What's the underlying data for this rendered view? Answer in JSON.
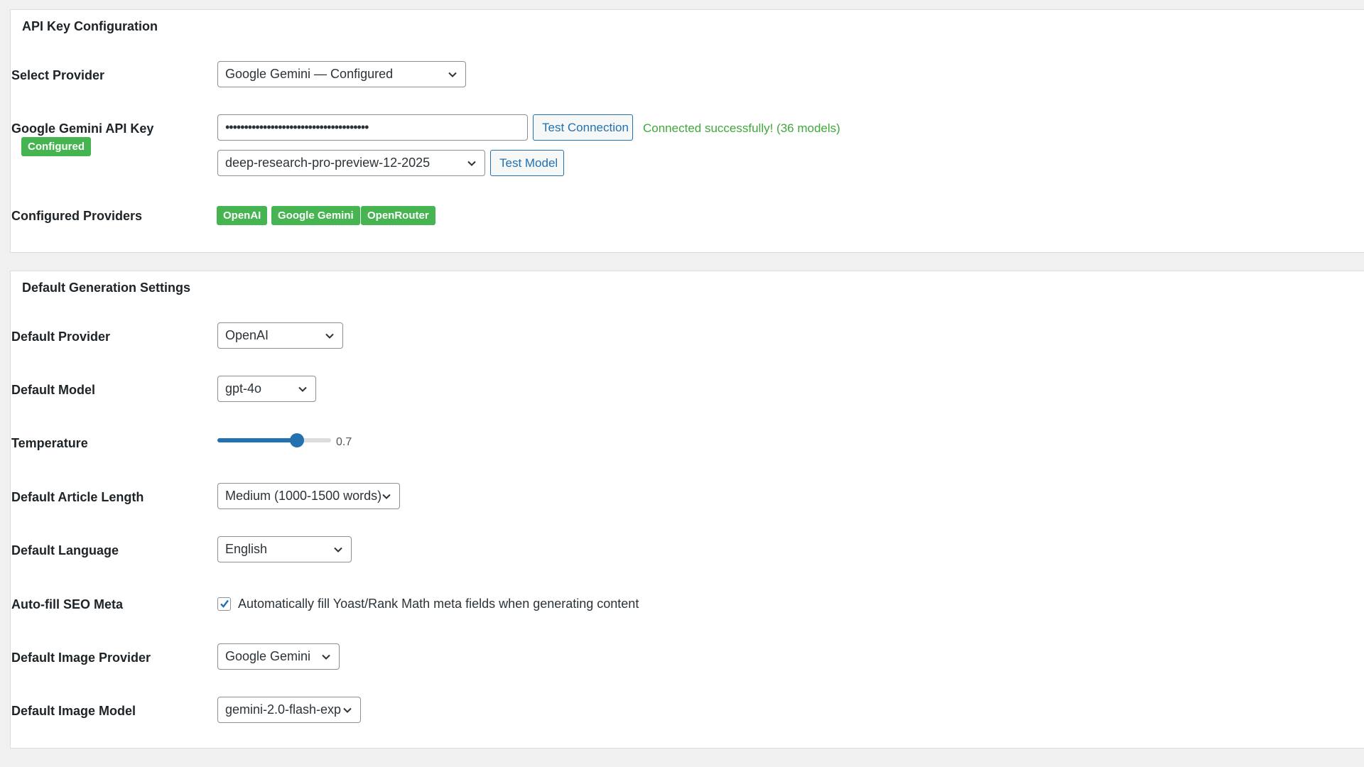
{
  "api_section": {
    "title": "API Key Configuration",
    "select_provider": {
      "label": "Select Provider",
      "value": "Google Gemini — Configured",
      "caret_icon": "chevron-down-icon"
    },
    "api_key": {
      "label": "Google Gemini API Key",
      "badge": "Configured",
      "value": "••••••••••••••••••••••••••••••••••••••",
      "test_button": "Test Connection",
      "status": "Connected successfully! (36 models)",
      "model_value": "deep-research-pro-preview-12-2025",
      "test_model_button": "Test Model"
    },
    "configured_providers": {
      "label": "Configured Providers",
      "items": [
        "OpenAI",
        "Google Gemini",
        "OpenRouter"
      ]
    }
  },
  "generation_section": {
    "title": "Default Generation Settings",
    "default_provider": {
      "label": "Default Provider",
      "value": "OpenAI"
    },
    "default_model": {
      "label": "Default Model",
      "value": "gpt-4o"
    },
    "temperature": {
      "label": "Temperature",
      "value": 0.7,
      "display": "0.7",
      "min": 0,
      "max": 1
    },
    "article_length": {
      "label": "Default Article Length",
      "value": "Medium (1000-1500 words)"
    },
    "language": {
      "label": "Default Language",
      "value": "English"
    },
    "autofill_seo": {
      "label": "Auto-fill SEO Meta",
      "checked": true,
      "text": "Automatically fill Yoast/Rank Math meta fields when generating content"
    },
    "image_provider": {
      "label": "Default Image Provider",
      "value": "Google Gemini"
    },
    "image_model": {
      "label": "Default Image Model",
      "value": "gemini-2.0-flash-exp"
    }
  },
  "colors": {
    "accent": "#2271b1",
    "success": "#46b450",
    "success_text": "#3fa83b",
    "background": "#f0f0f1"
  }
}
